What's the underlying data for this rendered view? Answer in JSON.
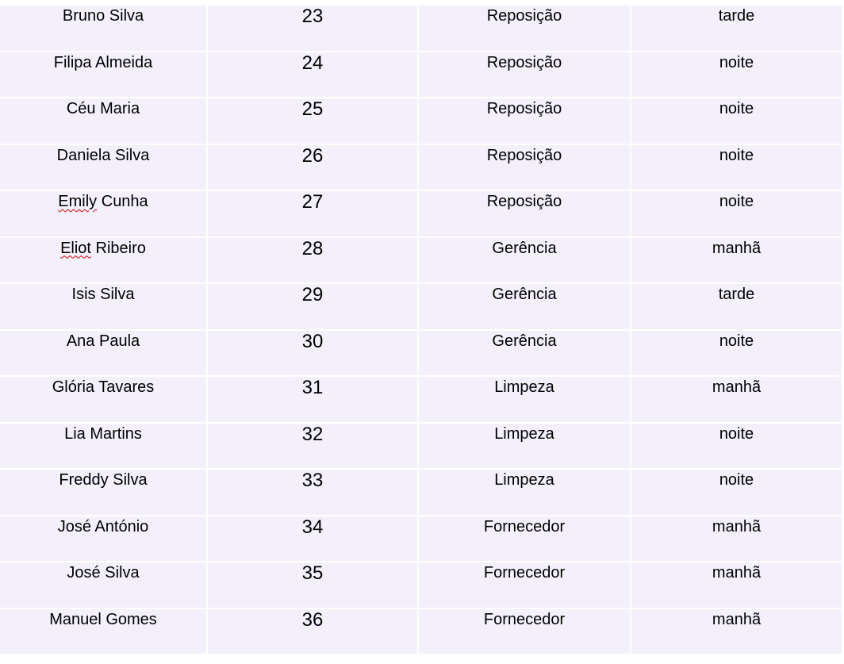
{
  "table": {
    "rows": [
      {
        "name": "Bruno Silva",
        "number": "23",
        "department": "Reposição",
        "shift": "tarde",
        "name_spellcheck": ""
      },
      {
        "name": "Filipa Almeida",
        "number": "24",
        "department": "Reposição",
        "shift": "noite",
        "name_spellcheck": ""
      },
      {
        "name": "Céu Maria",
        "number": "25",
        "department": "Reposição",
        "shift": "noite",
        "name_spellcheck": ""
      },
      {
        "name": "Daniela Silva",
        "number": "26",
        "department": "Reposição",
        "shift": "noite",
        "name_spellcheck": ""
      },
      {
        "name": "Emily Cunha",
        "number": "27",
        "department": "Reposição",
        "shift": "noite",
        "name_spellcheck": "Emily"
      },
      {
        "name": "Eliot Ribeiro",
        "number": "28",
        "department": "Gerência",
        "shift": "manhã",
        "name_spellcheck": "Eliot"
      },
      {
        "name": "Isis Silva",
        "number": "29",
        "department": "Gerência",
        "shift": "tarde",
        "name_spellcheck": ""
      },
      {
        "name": "Ana Paula",
        "number": "30",
        "department": "Gerência",
        "shift": "noite",
        "name_spellcheck": ""
      },
      {
        "name": "Glória Tavares",
        "number": "31",
        "department": "Limpeza",
        "shift": "manhã",
        "name_spellcheck": ""
      },
      {
        "name": "Lia Martins",
        "number": "32",
        "department": "Limpeza",
        "shift": "noite",
        "name_spellcheck": ""
      },
      {
        "name": "Freddy Silva",
        "number": "33",
        "department": "Limpeza",
        "shift": "noite",
        "name_spellcheck": ""
      },
      {
        "name": "José António",
        "number": "34",
        "department": "Fornecedor",
        "shift": "manhã",
        "name_spellcheck": ""
      },
      {
        "name": "José Silva",
        "number": "35",
        "department": "Fornecedor",
        "shift": "manhã",
        "name_spellcheck": ""
      },
      {
        "name": "Manuel Gomes",
        "number": "36",
        "department": "Fornecedor",
        "shift": "manhã",
        "name_spellcheck": ""
      }
    ]
  },
  "colors": {
    "cell_background": "#f4f0fb",
    "grid_lines": "#ffffff",
    "spellcheck_underline": "#d40000"
  }
}
